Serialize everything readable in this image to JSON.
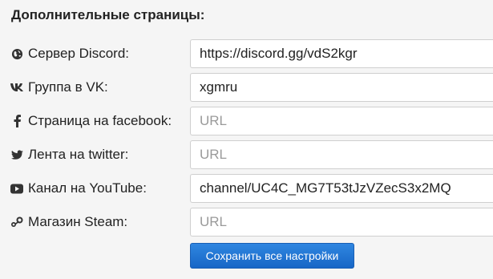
{
  "section": {
    "title": "Дополнительные страницы:"
  },
  "fields": [
    {
      "icon": "globe-icon",
      "label": "Сервер Discord:",
      "value": "https://discord.gg/vdS2kgr",
      "placeholder": "URL"
    },
    {
      "icon": "vk-icon",
      "label": "Группа в VK:",
      "value": "xgmru",
      "placeholder": "URL"
    },
    {
      "icon": "facebook-icon",
      "label": "Страница на facebook:",
      "value": "",
      "placeholder": "URL"
    },
    {
      "icon": "twitter-icon",
      "label": "Лента на twitter:",
      "value": "",
      "placeholder": "URL"
    },
    {
      "icon": "youtube-icon",
      "label": "Канал на YouTube:",
      "value": "channel/UC4C_MG7T53tJzVZecS3x2MQ",
      "placeholder": "URL"
    },
    {
      "icon": "steam-icon",
      "label": "Магазин Steam:",
      "value": "",
      "placeholder": "URL"
    }
  ],
  "actions": {
    "save_label": "Сохранить все настройки"
  },
  "colors": {
    "button": "#1f74d6",
    "background": "#f5f5f5"
  }
}
